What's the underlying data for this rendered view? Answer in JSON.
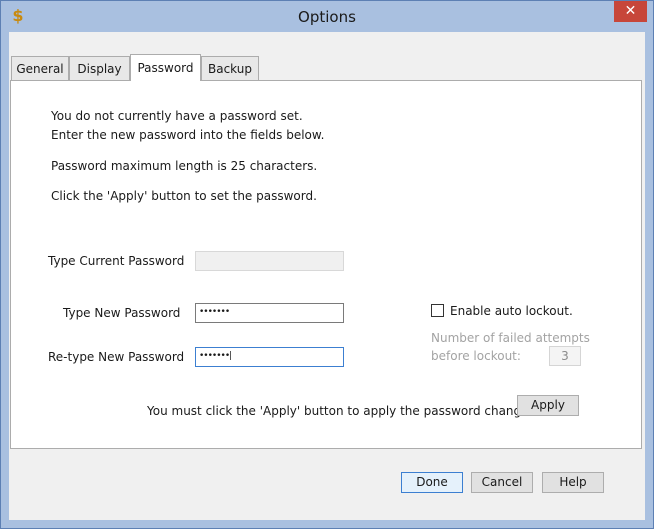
{
  "window": {
    "title": "Options",
    "close_label": "✕",
    "app_icon": "$"
  },
  "tabs": [
    {
      "label": "General"
    },
    {
      "label": "Display"
    },
    {
      "label": "Password"
    },
    {
      "label": "Backup"
    }
  ],
  "password": {
    "info": [
      "You do not currently have a password set.",
      "Enter the new password into the fields below.",
      "Password maximum length is 25 characters.",
      "Click the 'Apply' button to set the password."
    ],
    "current_label": "Type Current Password",
    "current_value": "",
    "new_label": "Type New Password",
    "new_value": "•••••••",
    "retype_label": "Re-type New Password",
    "retype_value": "•••••••|",
    "lockout_label": "Enable auto lockout.",
    "failed_label_1": "Number of failed attempts",
    "failed_label_2": "before lockout:",
    "failed_value": "3",
    "apply_note": "You must click the 'Apply' button to apply the password changes.",
    "apply_label": "Apply"
  },
  "footer": {
    "done_label": "Done",
    "cancel_label": "Cancel",
    "help_label": "Help"
  }
}
